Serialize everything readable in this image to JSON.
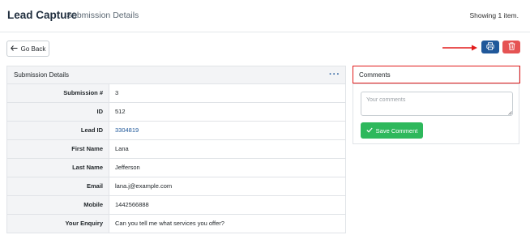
{
  "header": {
    "app_title": "Lead Capture",
    "page_subtitle": "Submission Details",
    "showing_text": "Showing 1 item."
  },
  "toolbar": {
    "go_back_label": "Go Back",
    "go_back_icon": "arrow-left-icon",
    "print_icon": "printer-icon",
    "delete_icon": "trash-icon"
  },
  "details": {
    "title": "Submission Details",
    "more_icon": "more-dots-icon",
    "rows": [
      {
        "label": "Submission #",
        "value": "3"
      },
      {
        "label": "ID",
        "value": "512"
      },
      {
        "label": "Lead ID",
        "value": "3304819"
      },
      {
        "label": "First Name",
        "value": "Lana"
      },
      {
        "label": "Last Name",
        "value": "Jefferson"
      },
      {
        "label": "Email",
        "value": "lana.j@example.com"
      },
      {
        "label": "Mobile",
        "value": "1442566888"
      },
      {
        "label": "Your Enquiry",
        "value": "Can you tell me what services you offer?"
      }
    ]
  },
  "comments": {
    "title": "Comments",
    "placeholder": "Your comments",
    "value": "",
    "save_label": "Save Comment"
  },
  "colors": {
    "primary": "#20589a",
    "danger": "#e55353",
    "success": "#2eb85c",
    "highlight": "#e21b1b"
  }
}
